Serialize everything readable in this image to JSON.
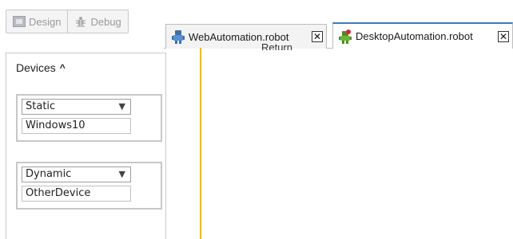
{
  "toolbar": {
    "design_label": "Design",
    "debug_label": "Debug"
  },
  "tabs": [
    {
      "label": "WebAutomation.robot",
      "close": "✕",
      "active": false
    },
    {
      "label": "DesktopAutomation.robot",
      "close": "✕",
      "active": true
    }
  ],
  "panel": {
    "title": "Devices",
    "caret": "^",
    "devices": [
      {
        "type": "Static",
        "name": "Windows10"
      },
      {
        "type": "Dynamic",
        "name": "OtherDevice"
      }
    ],
    "dropdown_arrow": "▼"
  },
  "editor": {
    "partial_text": "Return"
  },
  "colors": {
    "splitter": "#f0b829",
    "active_tab_top": "#3b78c4",
    "robot_green": "#5a9e2f",
    "robot_blue": "#3e6ea8"
  }
}
